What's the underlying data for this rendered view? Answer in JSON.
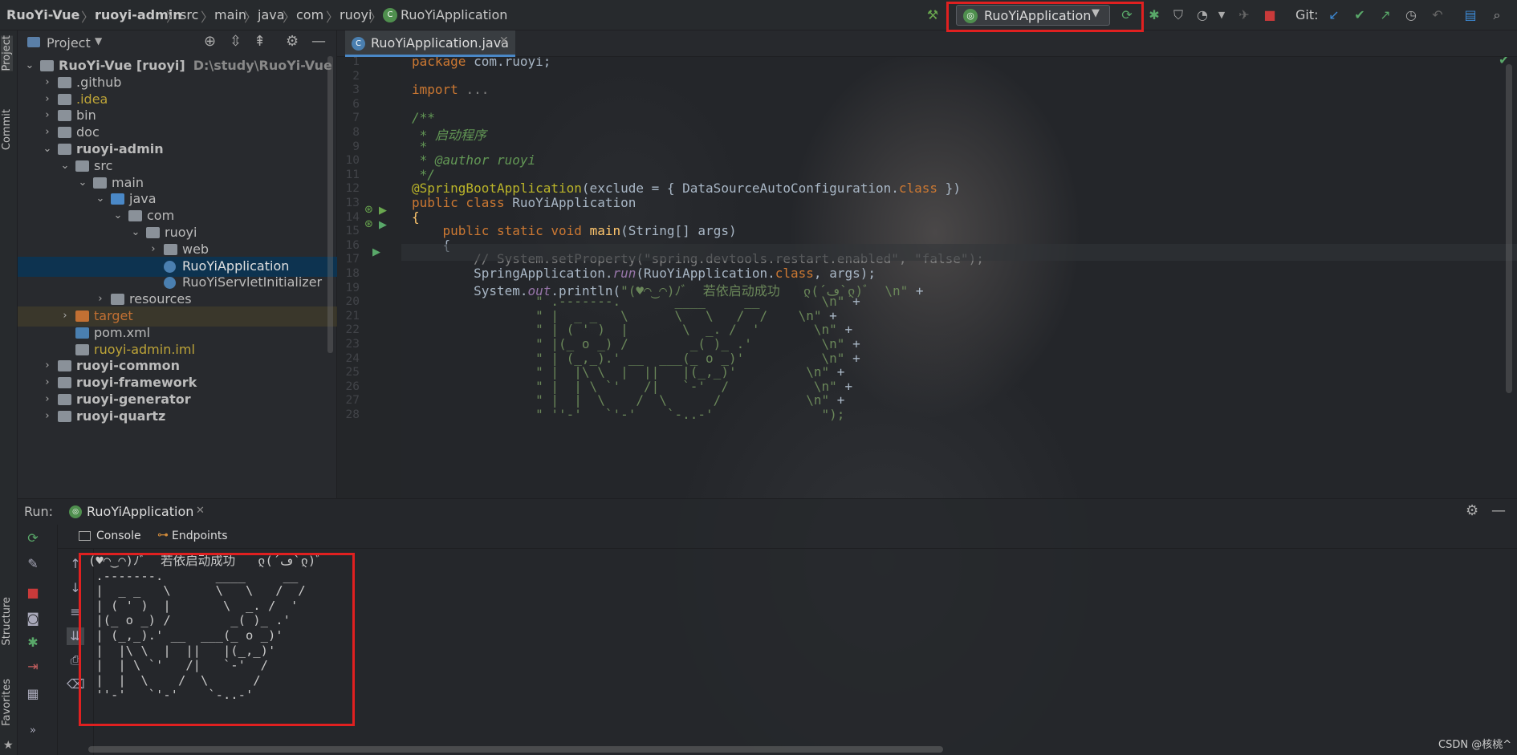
{
  "breadcrumbs": [
    "RuoYi-Vue",
    "ruoyi-admin",
    "src",
    "main",
    "java",
    "com",
    "ruoyi",
    "RuoYiApplication"
  ],
  "toolbar": {
    "run_config": "RuoYiApplication",
    "git_label": "Git:"
  },
  "side_strip": {
    "project": "Project",
    "commit": "Commit",
    "structure": "Structure",
    "favorites": "Favorites"
  },
  "project_panel": {
    "title": "Project",
    "tree": [
      {
        "label": "RuoYi-Vue [ruoyi]",
        "hint": "D:\\study\\RuoYi-Vue",
        "depth": 0,
        "expanded": true,
        "icon": "module-folder-icon"
      },
      {
        "label": ".github",
        "depth": 1,
        "icon": "folder-icon"
      },
      {
        "label": ".idea",
        "depth": 1,
        "icon": "folder-icon"
      },
      {
        "label": "bin",
        "depth": 1,
        "icon": "folder-icon"
      },
      {
        "label": "doc",
        "depth": 1,
        "icon": "folder-icon"
      },
      {
        "label": "ruoyi-admin",
        "depth": 1,
        "expanded": true,
        "icon": "module-folder-icon"
      },
      {
        "label": "src",
        "depth": 2,
        "expanded": true,
        "icon": "folder-icon"
      },
      {
        "label": "main",
        "depth": 3,
        "expanded": true,
        "icon": "folder-icon"
      },
      {
        "label": "java",
        "depth": 4,
        "expanded": true,
        "icon": "source-folder-icon"
      },
      {
        "label": "com",
        "depth": 5,
        "expanded": true,
        "icon": "package-icon"
      },
      {
        "label": "ruoyi",
        "depth": 6,
        "expanded": true,
        "icon": "package-icon"
      },
      {
        "label": "web",
        "depth": 7,
        "icon": "package-icon"
      },
      {
        "label": "RuoYiApplication",
        "depth": 7,
        "icon": "spring-class-icon",
        "selected": true
      },
      {
        "label": "RuoYiServletInitializer",
        "depth": 7,
        "icon": "class-icon"
      },
      {
        "label": "resources",
        "depth": 4,
        "icon": "resources-folder-icon"
      },
      {
        "label": "target",
        "depth": 2,
        "icon": "excluded-folder-icon"
      },
      {
        "label": "pom.xml",
        "depth": 2,
        "icon": "maven-icon"
      },
      {
        "label": "ruoyi-admin.iml",
        "depth": 2,
        "icon": "iml-file-icon"
      },
      {
        "label": "ruoyi-common",
        "depth": 1,
        "icon": "module-folder-icon"
      },
      {
        "label": "ruoyi-framework",
        "depth": 1,
        "icon": "module-folder-icon"
      },
      {
        "label": "ruoyi-generator",
        "depth": 1,
        "icon": "module-folder-icon"
      },
      {
        "label": "ruoyi-quartz",
        "depth": 1,
        "icon": "module-folder-icon"
      }
    ]
  },
  "editor": {
    "tab_label": "RuoYiApplication.java",
    "lines": [
      {
        "n": "1",
        "parts": [
          [
            "kw",
            "package "
          ],
          [
            "",
            "com.ruoyi;"
          ]
        ]
      },
      {
        "n": "2",
        "parts": []
      },
      {
        "n": "3",
        "parts": [
          [
            "kw",
            "import "
          ],
          [
            "cm",
            "..."
          ]
        ]
      },
      {
        "n": "6",
        "parts": []
      },
      {
        "n": "7",
        "parts": [
          [
            "cmi",
            "/**"
          ]
        ]
      },
      {
        "n": "8",
        "parts": [
          [
            "cmi",
            " * 启动程序"
          ]
        ]
      },
      {
        "n": "9",
        "parts": [
          [
            "cmi",
            " *"
          ]
        ]
      },
      {
        "n": "10",
        "parts": [
          [
            "cmi",
            " * @author ruoyi"
          ]
        ]
      },
      {
        "n": "11",
        "parts": [
          [
            "cmi",
            " */"
          ]
        ]
      },
      {
        "n": "12",
        "parts": [
          [
            "ann",
            "@SpringBootApplication"
          ],
          [
            "",
            "(exclude = { DataSourceAutoConfiguration."
          ],
          [
            "kw",
            "class"
          ],
          [
            "",
            " })"
          ]
        ]
      },
      {
        "n": "13",
        "parts": [
          [
            "kw",
            "public class "
          ],
          [
            "",
            "RuoYiApplication"
          ]
        ]
      },
      {
        "n": "14",
        "parts": [
          [
            "fn",
            "{"
          ]
        ]
      },
      {
        "n": "15",
        "parts": [
          [
            "kw",
            "    public static void "
          ],
          [
            "fn",
            "main"
          ],
          [
            "",
            "(String[] args)"
          ]
        ]
      },
      {
        "n": "16",
        "parts": [
          [
            "",
            "    {"
          ]
        ]
      },
      {
        "n": "17",
        "parts": [
          [
            "cm",
            "        // System.setProperty(\"spring.devtools.restart.enabled\", \"false\");"
          ]
        ]
      },
      {
        "n": "18",
        "parts": [
          [
            "",
            "        SpringApplication."
          ],
          [
            "it",
            "run"
          ],
          [
            "",
            "(RuoYiApplication."
          ],
          [
            "kw",
            "class"
          ],
          [
            "",
            ", args);"
          ]
        ]
      },
      {
        "n": "19",
        "parts": [
          [
            "",
            "        System."
          ],
          [
            "it",
            "out"
          ],
          [
            "",
            ".println("
          ],
          [
            "str",
            "\"(♥◠‿◠)ﾉﾞ  若依启动成功   ლ(´ڡ`ლ)ﾞ  \\n\""
          ],
          [
            "",
            " +"
          ]
        ]
      },
      {
        "n": "20",
        "parts": [
          [
            "str",
            "                \" .-------.       ____     __        \\n\""
          ],
          [
            "",
            " +"
          ]
        ]
      },
      {
        "n": "21",
        "parts": [
          [
            "str",
            "                \" |  _ _   \\      \\   \\   /  /    \\n\""
          ],
          [
            "",
            " +"
          ]
        ]
      },
      {
        "n": "22",
        "parts": [
          [
            "str",
            "                \" | ( ' )  |       \\  _. /  '       \\n\""
          ],
          [
            "",
            " +"
          ]
        ]
      },
      {
        "n": "23",
        "parts": [
          [
            "str",
            "                \" |(_ o _) /        _( )_ .'         \\n\""
          ],
          [
            "",
            " +"
          ]
        ]
      },
      {
        "n": "24",
        "parts": [
          [
            "str",
            "                \" | (_,_).' __  ___(_ o _)'          \\n\""
          ],
          [
            "",
            " +"
          ]
        ]
      },
      {
        "n": "25",
        "parts": [
          [
            "str",
            "                \" |  |\\ \\  |  ||   |(_,_)'         \\n\""
          ],
          [
            "",
            " +"
          ]
        ]
      },
      {
        "n": "26",
        "parts": [
          [
            "str",
            "                \" |  | \\ `'   /|   `-'  /           \\n\""
          ],
          [
            "",
            " +"
          ]
        ]
      },
      {
        "n": "27",
        "parts": [
          [
            "str",
            "                \" |  |  \\    /  \\      /           \\n\""
          ],
          [
            "",
            " +"
          ]
        ]
      },
      {
        "n": "28",
        "parts": [
          [
            "str",
            "                \" ''-'   `'-'    `-..-'              \");"
          ]
        ]
      }
    ]
  },
  "run_panel": {
    "title": "Run:",
    "tab_label": "RuoYiApplication",
    "console_tab": "Console",
    "endpoints_tab": "Endpoints",
    "console_lines": [
      "(♥◠‿◠)ﾉﾞ  若依启动成功   ლ(´ڡ`ლ)ﾞ",
      " .-------.       ____     __",
      " |  _ _   \\      \\   \\   /  /",
      " | ( ' )  |       \\  _. /  '",
      " |(_ o _) /        _( )_ .'",
      " | (_,_).' __  ___(_ o _)'",
      " |  |\\ \\  |  ||   |(_,_)'",
      " |  | \\ `'   /|   `-'  /",
      " |  |  \\    /  \\      /",
      " ''-'   `'-'    `-..-'"
    ]
  },
  "watermark": "CSDN @核桃^"
}
